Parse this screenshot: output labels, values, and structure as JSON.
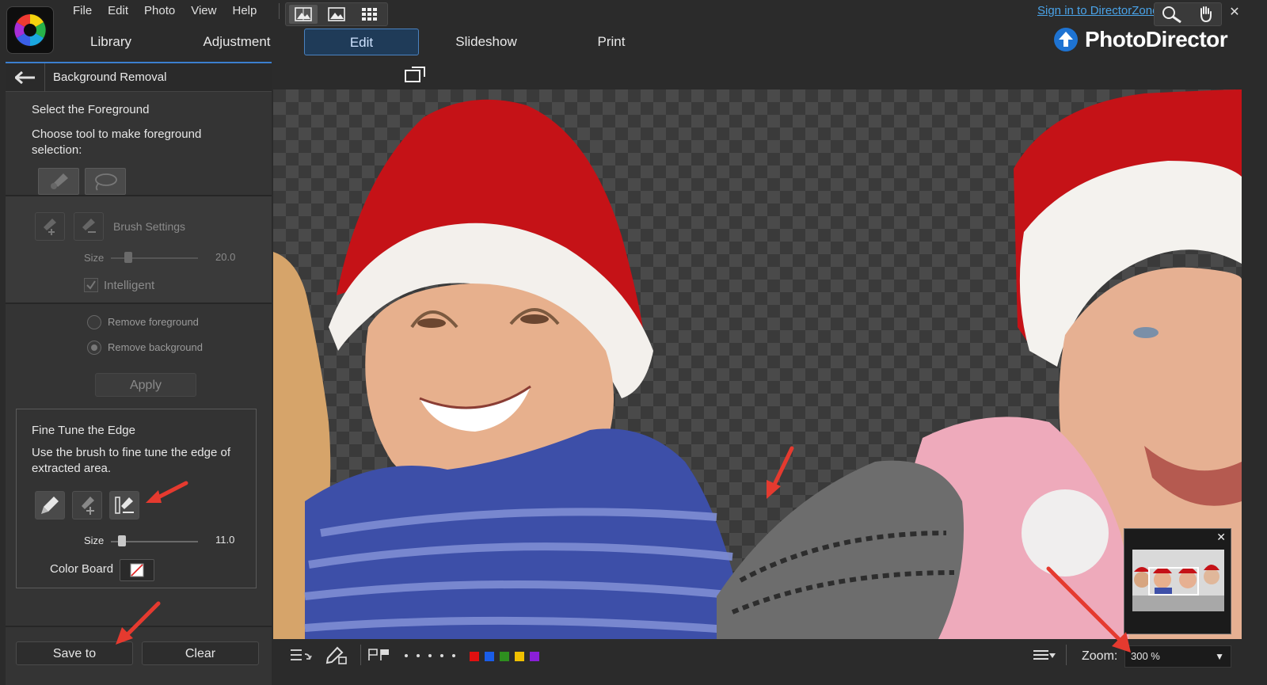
{
  "menu": [
    "File",
    "Edit",
    "Photo",
    "View",
    "Help"
  ],
  "signin": "Sign in to DirectorZone",
  "window": {
    "help": "?",
    "minimize": "–",
    "restore": "❐",
    "close": "✕"
  },
  "modes": [
    "Library",
    "Adjustment",
    "Edit",
    "Slideshow",
    "Print"
  ],
  "active_mode": "Edit",
  "brand": "PhotoDirector",
  "panel": {
    "title": "Background Removal",
    "select_heading": "Select the Foreground",
    "select_desc": "Choose tool to make foreground selection:",
    "brush_settings": "Brush Settings",
    "size_label": "Size",
    "size_value": "20.0",
    "intelligent": "Intelligent",
    "remove_foreground": "Remove foreground",
    "remove_background": "Remove background",
    "apply": "Apply",
    "fine_heading": "Fine Tune the Edge",
    "fine_desc": "Use the brush to fine tune the edge of extracted area.",
    "fine_size_label": "Size",
    "fine_size_value": "11.0",
    "color_board": "Color Board",
    "save_to": "Save to",
    "clear": "Clear"
  },
  "bottom": {
    "zoom_label": "Zoom:",
    "zoom_value": "300 %",
    "color_labels": [
      "#e01010",
      "#1a5de8",
      "#2e8f1f",
      "#f0c000",
      "#8a1fd8"
    ]
  }
}
